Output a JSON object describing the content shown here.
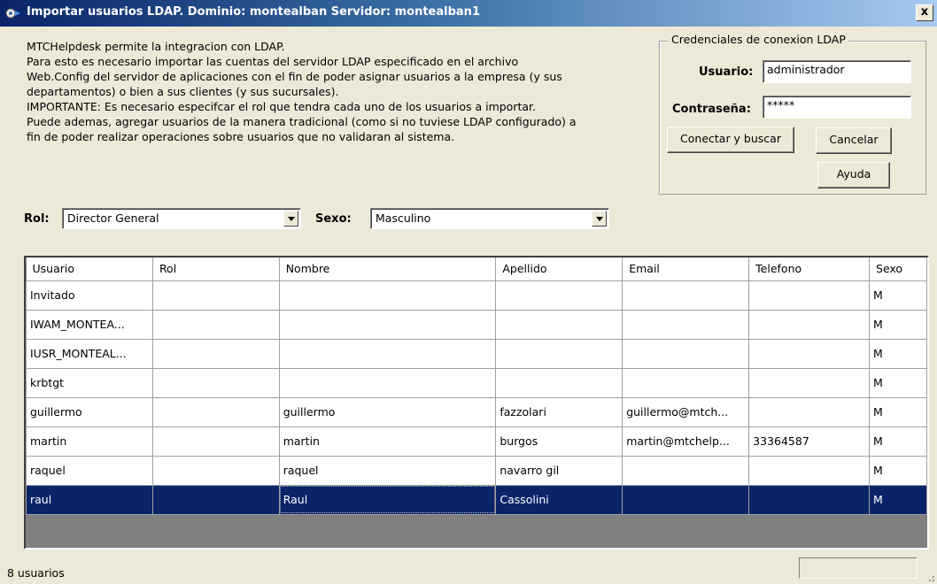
{
  "window": {
    "title": "Importar usuarios LDAP. Dominio: montealban Servidor: montealban1",
    "close_label": "x",
    "icon": "app-gear-icon"
  },
  "info": {
    "lines": [
      "MTCHelpdesk permite la integracion con LDAP.",
      "Para esto es necesario importar las cuentas del servidor LDAP especificado en el archivo",
      "Web.Config del servidor de aplicaciones con el fin de poder asignar usuarios a la empresa (y sus",
      "departamentos) o bien a sus clientes (y sus sucursales).",
      "IMPORTANTE: Es necesario especifcar el rol que tendra cada uno de los usuarios a importar.",
      "Puede ademas, agregar usuarios de la manera tradicional (como si no tuviese LDAP configurado) a",
      "fin de poder realizar operaciones sobre usuarios que no validaran al sistema."
    ]
  },
  "credentials": {
    "legend": "Credenciales de conexion LDAP",
    "user_label": "Usuario:",
    "user_value": "administrador",
    "password_label": "Contraseña:",
    "password_value": "*****",
    "connect_button": "Conectar y buscar",
    "cancel_button": "Cancelar",
    "help_button": "Ayuda"
  },
  "filters": {
    "rol_label": "Rol:",
    "rol_value": "Director General",
    "sexo_label": "Sexo:",
    "sexo_value": "Masculino"
  },
  "grid": {
    "columns": [
      "Usuario",
      "Rol",
      "Nombre",
      "Apellido",
      "Email",
      "Telefono",
      "Sexo"
    ],
    "rows": [
      [
        "Invitado",
        "",
        "",
        "",
        "",
        "",
        "M"
      ],
      [
        "IWAM_MONTEA...",
        "",
        "",
        "",
        "",
        "",
        "M"
      ],
      [
        "IUSR_MONTEAL...",
        "",
        "",
        "",
        "",
        "",
        "M"
      ],
      [
        "krbtgt",
        "",
        "",
        "",
        "",
        "",
        "M"
      ],
      [
        "guillermo",
        "",
        "guillermo",
        "fazzolari",
        "guillermo@mtch...",
        "",
        "M"
      ],
      [
        "martin",
        "",
        "martin",
        "burgos",
        "martin@mtchelp...",
        "33364587",
        "M"
      ],
      [
        "raquel",
        "",
        "raquel",
        "navarro gil",
        "",
        "",
        "M"
      ],
      [
        "raul",
        "",
        "Raul",
        "Cassolini",
        "",
        "",
        "M"
      ]
    ],
    "selected_row": 7
  },
  "status": {
    "text": "8 usuarios"
  },
  "colors": {
    "selection": "#0a246a",
    "titlebar_start": "#0a246a",
    "face": "#ece9d8"
  }
}
